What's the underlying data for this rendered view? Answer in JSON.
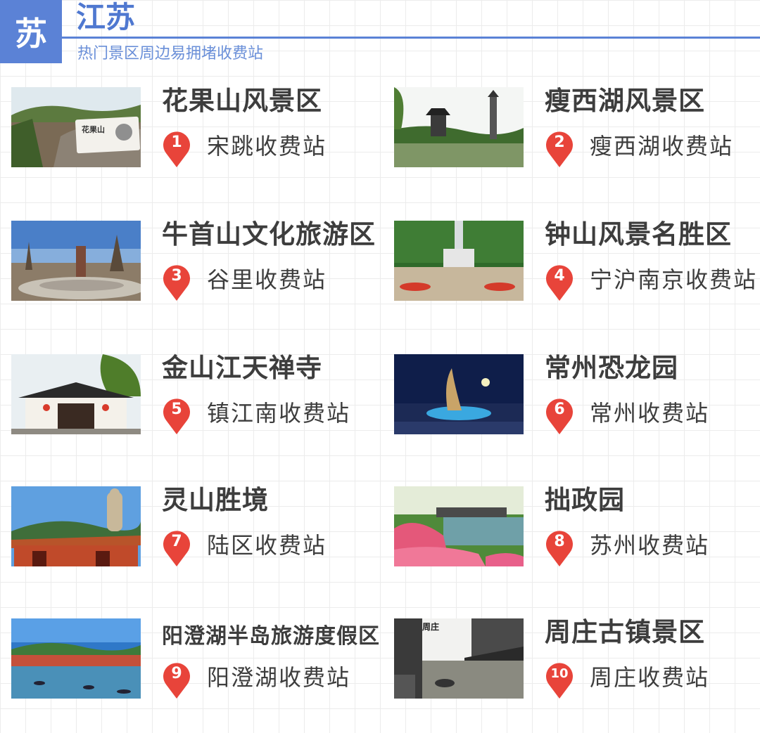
{
  "header": {
    "badge": "苏",
    "province": "江苏",
    "subtitle": "热门景区周边易拥堵收费站"
  },
  "colors": {
    "accent": "#5b82d6",
    "pin": "#e8443a",
    "text": "#3d3d3d"
  },
  "spots": [
    {
      "number": "1",
      "name": "花果山风景区",
      "station": "宋跳收费站"
    },
    {
      "number": "2",
      "name": "瘦西湖风景区",
      "station": "瘦西湖收费站"
    },
    {
      "number": "3",
      "name": "牛首山文化旅游区",
      "station": "谷里收费站"
    },
    {
      "number": "4",
      "name": "钟山风景名胜区",
      "station": "宁沪南京收费站"
    },
    {
      "number": "5",
      "name": "金山江天禅寺",
      "station": "镇江南收费站"
    },
    {
      "number": "6",
      "name": "常州恐龙园",
      "station": "常州收费站"
    },
    {
      "number": "7",
      "name": "灵山胜境",
      "station": "陆区收费站"
    },
    {
      "number": "8",
      "name": "拙政园",
      "station": "苏州收费站"
    },
    {
      "number": "9",
      "name": "阳澄湖半岛旅游度假区",
      "station": "阳澄湖收费站"
    },
    {
      "number": "10",
      "name": "周庄古镇景区",
      "station": "周庄收费站"
    }
  ],
  "photo_captions": {
    "huaguoshan_stone": "花果山",
    "zhouzhuang_sign": "周庄"
  }
}
